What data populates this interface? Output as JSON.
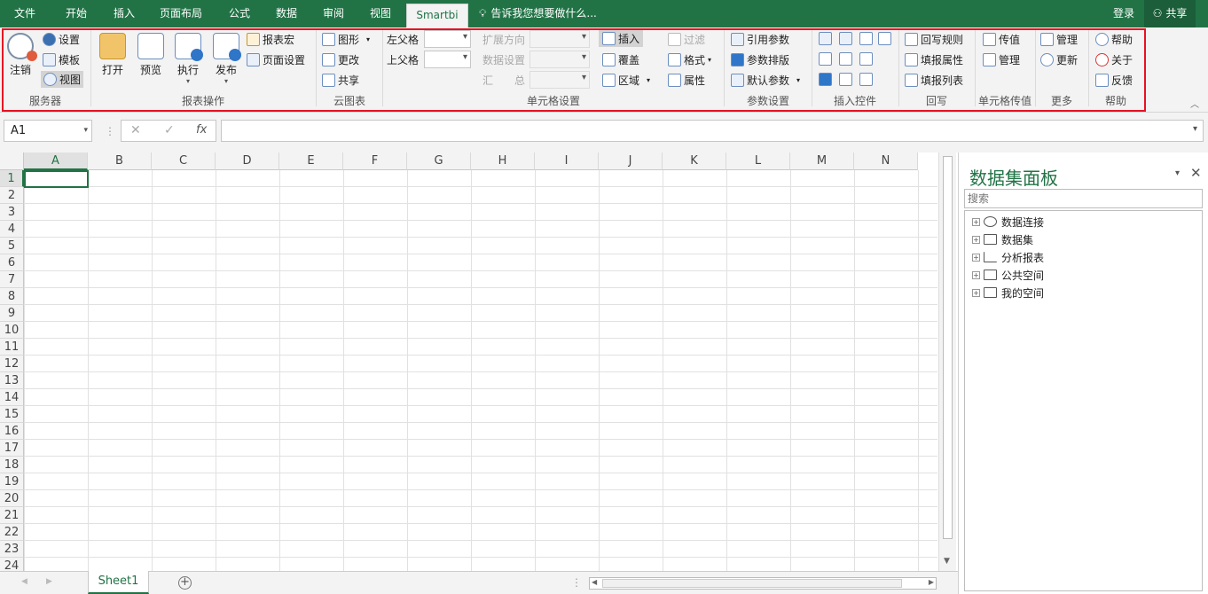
{
  "tabs": {
    "file": "文件",
    "home": "开始",
    "insert": "插入",
    "layout": "页面布局",
    "formulas": "公式",
    "data": "数据",
    "review": "审阅",
    "view": "视图",
    "smartbi": "Smartbi",
    "tellme": "告诉我您想要做什么...",
    "login": "登录",
    "share": "共享"
  },
  "ribbon": {
    "server": {
      "logout": "注销",
      "settings": "设置",
      "template": "模板",
      "view": "视图",
      "label": "服务器"
    },
    "report": {
      "open": "打开",
      "preview": "预览",
      "execute": "执行",
      "publish": "发布",
      "macro": "报表宏",
      "page_setup": "页面设置",
      "label": "报表操作"
    },
    "cloud": {
      "chart": "图形",
      "change": "更改",
      "share": "共享",
      "label": "云图表"
    },
    "cell": {
      "left_parent": "左父格",
      "top_parent": "上父格",
      "expand_dir": "扩展方向",
      "data_setting": "数据设置",
      "summary": "汇　　总",
      "insert": "插入",
      "overwrite": "覆盖",
      "area": "区域",
      "filter": "过滤",
      "format": "格式",
      "property": "属性",
      "label": "单元格设置"
    },
    "param": {
      "ref": "引用参数",
      "layout": "参数排版",
      "default": "默认参数",
      "label": "参数设置"
    },
    "controls": {
      "label": "插入控件"
    },
    "writeback": {
      "rule": "回写规则",
      "fill_prop": "填报属性",
      "fill_list": "填报列表",
      "label": "回写"
    },
    "cellpass": {
      "pass": "传值",
      "manage": "管理",
      "label": "单元格传值"
    },
    "more": {
      "manage": "管理",
      "update": "更新",
      "label": "更多"
    },
    "help": {
      "help": "帮助",
      "about": "关于",
      "feedback": "反馈",
      "label": "帮助"
    }
  },
  "formula_bar": {
    "cell_ref": "A1",
    "fx": "fx",
    "value": ""
  },
  "columns": [
    "A",
    "B",
    "C",
    "D",
    "E",
    "F",
    "G",
    "H",
    "I",
    "J",
    "K",
    "L",
    "M",
    "N"
  ],
  "rows": [
    "1",
    "2",
    "3",
    "4",
    "5",
    "6",
    "7",
    "8",
    "9",
    "10",
    "11",
    "12",
    "13",
    "14",
    "15",
    "16",
    "17",
    "18",
    "19",
    "20",
    "21",
    "22",
    "23",
    "24"
  ],
  "sheet": {
    "name": "Sheet1"
  },
  "panel": {
    "title": "数据集面板",
    "search_placeholder": "搜索",
    "items": [
      "数据连接",
      "数据集",
      "分析报表",
      "公共空间",
      "我的空间"
    ]
  },
  "colors": {
    "accent": "#217346",
    "highlight": "#e81123"
  }
}
